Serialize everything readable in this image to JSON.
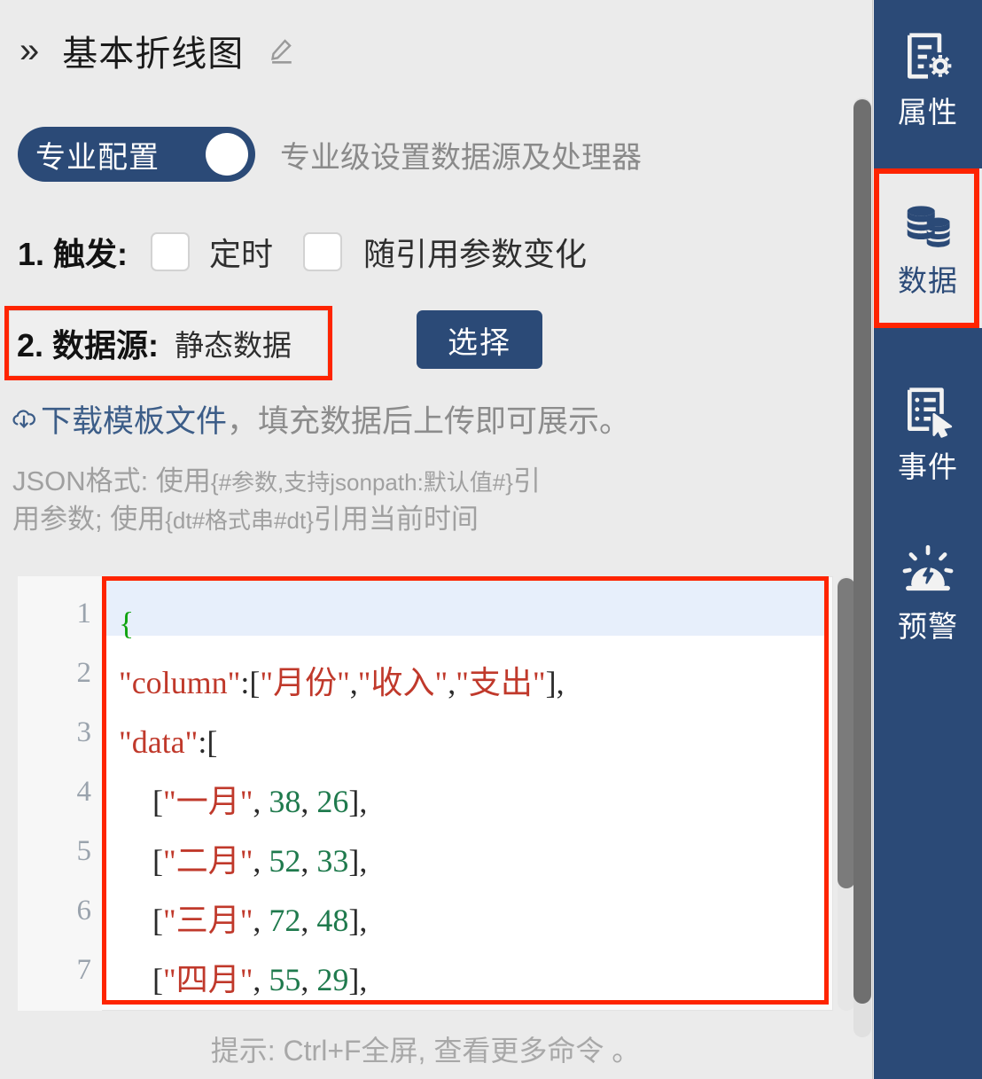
{
  "header": {
    "collapse_icon": "double-chevron-right-icon",
    "title": "基本折线图",
    "edit_icon": "pencil-icon"
  },
  "pro_toggle": {
    "label": "专业配置",
    "state": "on",
    "description": "专业级设置数据源及处理器"
  },
  "trigger": {
    "step_label": "1. 触发:",
    "options": [
      {
        "label": "定时",
        "checked": false
      },
      {
        "label": "随引用参数变化",
        "checked": false
      }
    ]
  },
  "datasource": {
    "step_label": "2. 数据源:",
    "value": "静态数据",
    "select_button": "选择",
    "highlighted": true
  },
  "download_hint": {
    "icon": "cloud-download-icon",
    "link_text": "下载模板文件",
    "rest_text": "，填充数据后上传即可展示。"
  },
  "json_help": {
    "line1_prefix": "JSON格式:  使用",
    "line1_param": "{#参数,支持jsonpath:默认值#}",
    "line1_suffix": "引",
    "line2_prefix": "用参数; 使用",
    "line2_param": "{dt#格式串#dt}",
    "line2_suffix": "引用当前时间"
  },
  "editor": {
    "highlighted": true,
    "active_line": 1,
    "line_numbers": [
      "1",
      "2",
      "3",
      "4",
      "5",
      "6",
      "7"
    ],
    "lines": [
      {
        "n": "1",
        "segments": [
          {
            "t": "brace",
            "s": "{"
          }
        ]
      },
      {
        "n": "2",
        "segments": [
          {
            "t": "str",
            "s": "\"column\""
          },
          {
            "t": "pun",
            "s": ":["
          },
          {
            "t": "str",
            "s": "\"月份\""
          },
          {
            "t": "pun",
            "s": ","
          },
          {
            "t": "str",
            "s": "\"收入\""
          },
          {
            "t": "pun",
            "s": ","
          },
          {
            "t": "str",
            "s": "\"支出\""
          },
          {
            "t": "pun",
            "s": "],"
          }
        ]
      },
      {
        "n": "3",
        "segments": [
          {
            "t": "str",
            "s": "\"data\""
          },
          {
            "t": "pun",
            "s": ":["
          }
        ]
      },
      {
        "n": "4",
        "segments": [
          {
            "t": "pun",
            "s": "["
          },
          {
            "t": "str",
            "s": "\"一月\""
          },
          {
            "t": "pun",
            "s": ", "
          },
          {
            "t": "num",
            "s": "38"
          },
          {
            "t": "pun",
            "s": ", "
          },
          {
            "t": "num",
            "s": "26"
          },
          {
            "t": "pun",
            "s": "],"
          }
        ]
      },
      {
        "n": "5",
        "segments": [
          {
            "t": "pun",
            "s": "["
          },
          {
            "t": "str",
            "s": "\"二月\""
          },
          {
            "t": "pun",
            "s": ", "
          },
          {
            "t": "num",
            "s": "52"
          },
          {
            "t": "pun",
            "s": ", "
          },
          {
            "t": "num",
            "s": "33"
          },
          {
            "t": "pun",
            "s": "],"
          }
        ]
      },
      {
        "n": "6",
        "segments": [
          {
            "t": "pun",
            "s": "["
          },
          {
            "t": "str",
            "s": "\"三月\""
          },
          {
            "t": "pun",
            "s": ", "
          },
          {
            "t": "num",
            "s": "72"
          },
          {
            "t": "pun",
            "s": ", "
          },
          {
            "t": "num",
            "s": "48"
          },
          {
            "t": "pun",
            "s": "],"
          }
        ]
      },
      {
        "n": "7",
        "segments": [
          {
            "t": "pun",
            "s": "["
          },
          {
            "t": "str",
            "s": "\"四月\""
          },
          {
            "t": "pun",
            "s": ", "
          },
          {
            "t": "num",
            "s": "55"
          },
          {
            "t": "pun",
            "s": ", "
          },
          {
            "t": "num",
            "s": "29"
          },
          {
            "t": "pun",
            "s": "],"
          }
        ]
      }
    ]
  },
  "editor_payload": {
    "column": [
      "月份",
      "收入",
      "支出"
    ],
    "data": [
      [
        "一月",
        38,
        26
      ],
      [
        "二月",
        52,
        33
      ],
      [
        "三月",
        72,
        48
      ],
      [
        "四月",
        55,
        29
      ]
    ]
  },
  "tip": "提示: Ctrl+F全屏, 查看更多命令 。",
  "sidebar": {
    "items": [
      {
        "label": "属性",
        "icon": "document-gear-icon",
        "active": false
      },
      {
        "label": "数据",
        "icon": "database-stack-icon",
        "active": true
      },
      {
        "label": "事件",
        "icon": "list-cursor-icon",
        "active": false
      },
      {
        "label": "预警",
        "icon": "alarm-bolt-icon",
        "active": false
      }
    ]
  },
  "colors": {
    "navy": "#2b4a77",
    "highlight_red": "#fe2400",
    "page_bg": "#ebebeb",
    "link_blue": "#3c5d88",
    "code_string": "#c0392b",
    "code_number": "#1f7a4d",
    "code_brace": "#10a310"
  }
}
